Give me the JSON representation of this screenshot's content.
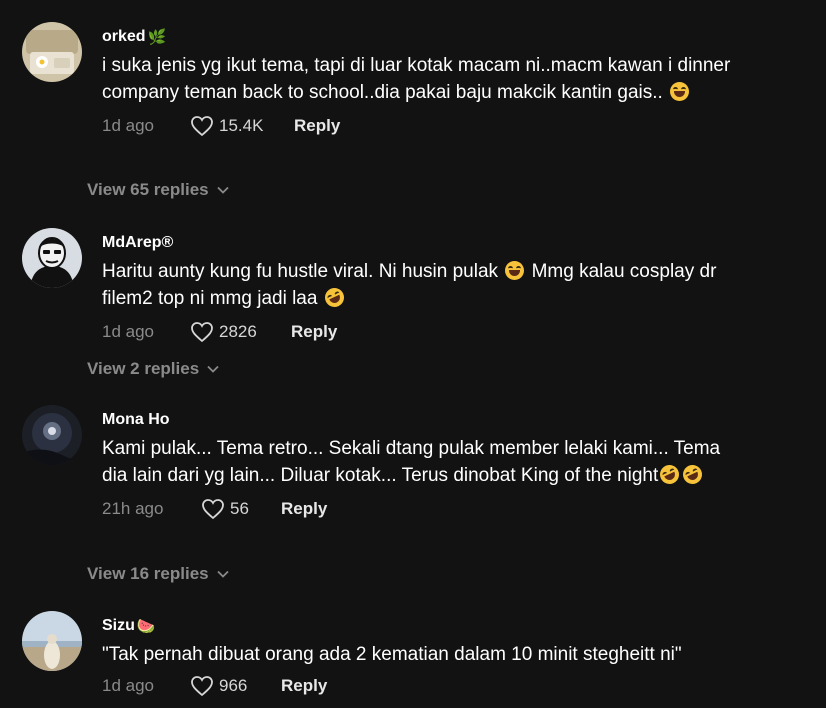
{
  "comments": [
    {
      "username": "orked",
      "username_emoji": "🌿",
      "text": "i suka jenis yg ikut tema, tapi di luar kotak macam ni..macm kawan i dinner company teman back to school..dia pakai baju makcik kantin gais..",
      "time": "1d ago",
      "likes": "15.4K",
      "reply_label": "Reply",
      "view_replies": "View 65 replies"
    },
    {
      "username": "MdArep®",
      "text_parts": [
        "Haritu aunty kung fu hustle viral. Ni husin pulak ",
        " Mmg kalau cosplay dr filem2 top ni mmg jadi laa "
      ],
      "time": "1d ago",
      "likes": "2826",
      "reply_label": "Reply",
      "view_replies": "View 2 replies"
    },
    {
      "username": "Mona Ho",
      "text": "Kami pulak... Tema retro... Sekali dtang pulak member lelaki kami... Tema dia lain dari yg lain... Diluar kotak... Terus dinobat King of the night",
      "time": "21h ago",
      "likes": "56",
      "reply_label": "Reply",
      "view_replies": "View 16 replies"
    },
    {
      "username": "Sizu",
      "username_emoji": "🍉",
      "text": "\"Tak pernah dibuat orang ada 2 kematian dalam 10 minit stegheitt ni\"",
      "time": "1d ago",
      "likes": "966",
      "reply_label": "Reply"
    }
  ],
  "colors": {
    "background": "#121212",
    "muted_text": "#8a8a8a",
    "primary_text": "#ffffff"
  },
  "icons": {
    "like": "heart-outline-icon",
    "expand": "chevron-down-icon"
  }
}
